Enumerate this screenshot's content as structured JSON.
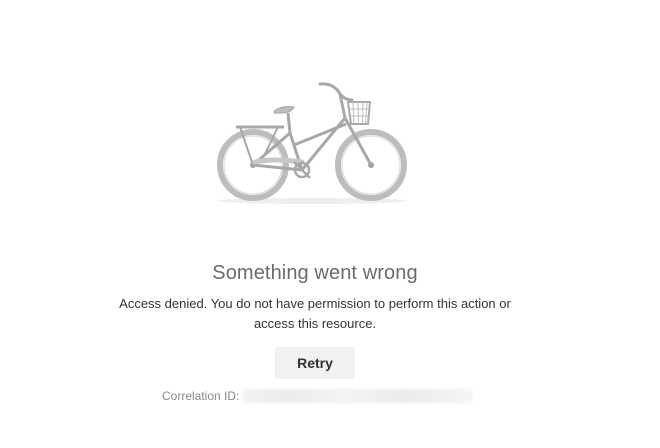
{
  "error": {
    "title": "Something went wrong",
    "message": "Access denied. You do not have permission to perform this action or access this resource.",
    "retry_label": "Retry",
    "correlation_label": "Correlation ID:"
  },
  "illustration": {
    "icon": "bicycle-illustration",
    "color": "#a8a8a8"
  }
}
